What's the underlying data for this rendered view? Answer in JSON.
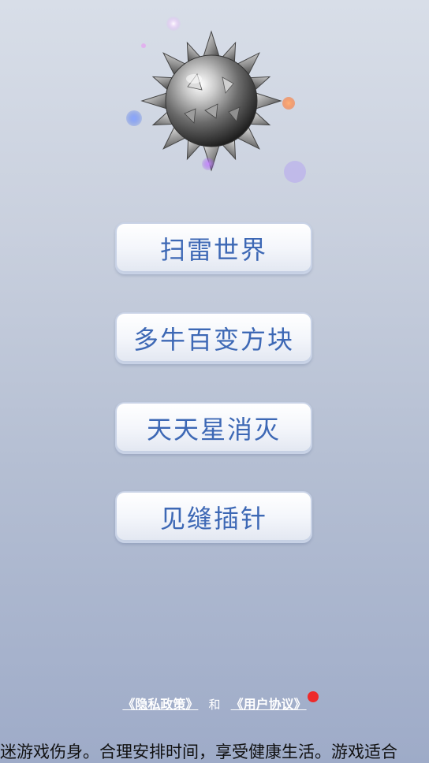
{
  "logo": {
    "icon": "mine-icon"
  },
  "menu": {
    "items": [
      {
        "label": "扫雷世界"
      },
      {
        "label": "多牛百变方块"
      },
      {
        "label": "天天星消灭"
      },
      {
        "label": "见缝插针"
      }
    ]
  },
  "footer": {
    "privacy_link": "《隐私政策》",
    "separator": "和",
    "agreement_link": "《用户协议》",
    "notice": "迷游戏伤身。合理安排时间，享受健康生活。游戏适合"
  },
  "colors": {
    "button_text": "#3d68b5",
    "notification_dot": "#ee2a2a"
  }
}
